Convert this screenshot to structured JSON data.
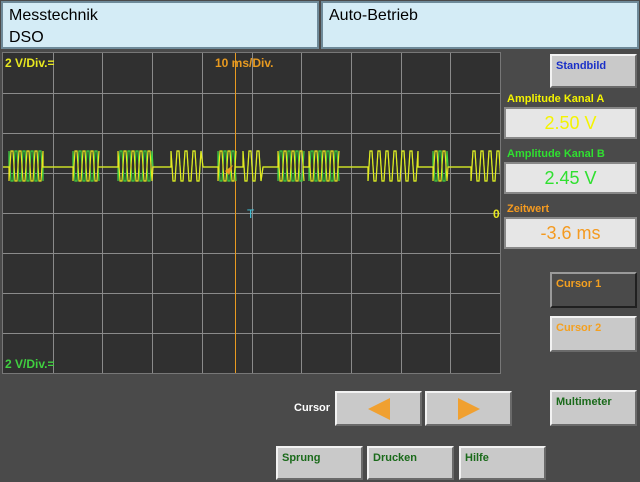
{
  "header": {
    "left_line1": "Messtechnik",
    "left_line2": "DSO",
    "right_title": "Auto-Betrieb"
  },
  "scope": {
    "ch_a_scale": "2 V/Div.=",
    "time_scale": "10 ms/Div.",
    "ch_b_scale": "2 V/Div.=",
    "trigger_marker": "T",
    "zero_marker": "0"
  },
  "side": {
    "standbild_label": "Standbild",
    "amp_a_label": "Amplitude Kanal A",
    "amp_a_value": "2.50 V",
    "amp_b_label": "Amplitude Kanal B",
    "amp_b_value": "2.45 V",
    "zeit_label": "Zeitwert",
    "zeit_value": "-3.6 ms",
    "cursor1_label": "Cursor 1",
    "cursor2_label": "Cursor 2",
    "multimeter_label": "Multimeter"
  },
  "bottom": {
    "cursor_label": "Cursor",
    "sprung_label": "Sprung",
    "drucken_label": "Drucken",
    "hilfe_label": "Hilfe"
  },
  "colors": {
    "channel_a": "#e8e820",
    "channel_b": "#40d040",
    "cursor_line": "#e89a20",
    "trigger": "#40c8e0",
    "arrow": "#f0a030",
    "standbild_text": "#1a30c8",
    "value_yellow": "#f4f400",
    "value_green": "#30e030",
    "value_orange": "#f49a20"
  }
}
